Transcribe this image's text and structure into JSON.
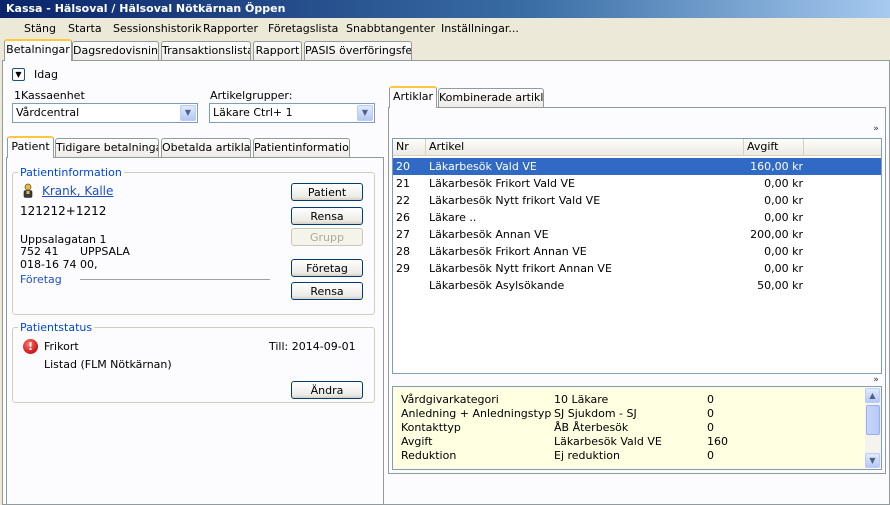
{
  "window": {
    "title": "Kassa - Hälsoval / Hälsoval Nötkärnan Öppen"
  },
  "menu": [
    "Stäng",
    "Starta",
    "Sessionshistorik",
    "Rapporter",
    "Företagslista",
    "Snabbtangenter",
    "Inställningar..."
  ],
  "main_tabs": [
    "Betalningar",
    "Dagsredovisning",
    "Transaktionslista",
    "Rapport",
    "PASIS överföringsfel"
  ],
  "date_toggle": "Idag",
  "kassaenhet": {
    "label": "1Kassaenhet",
    "value": "Vårdcentral"
  },
  "artikelgrupper": {
    "label": "Artikelgrupper:",
    "value": "Läkare Ctrl+ 1"
  },
  "patient_tabs": [
    "Patient",
    "Tidigare betalningar",
    "Obetalda artiklar",
    "Patientinformation"
  ],
  "patientinfo": {
    "title": "Patientinformation",
    "name": "Krank, Kalle",
    "pnr": "121212+1212",
    "street": "Uppsalagatan 1",
    "zip": "752 41",
    "city": "UPPSALA",
    "phone": "018-16 74 00,",
    "company_label": "Företag",
    "buttons": {
      "patient": "Patient",
      "rensa1": "Rensa",
      "grupp": "Grupp",
      "foretag": "Företag",
      "rensa2": "Rensa"
    }
  },
  "patientstatus": {
    "title": "Patientstatus",
    "status": "Frikort",
    "date": "Till: 2014-09-01",
    "listed": "Listad (FLM Nötkärnan)",
    "andra": "Ändra"
  },
  "article_tabs": [
    "Artiklar",
    "Kombinerade artiklar"
  ],
  "articles": {
    "columns": [
      "Nr",
      "Artikel",
      "Avgift"
    ],
    "rows": [
      {
        "nr": "20",
        "name": "Läkarbesök Vald VE",
        "fee": "160,00 kr"
      },
      {
        "nr": "21",
        "name": "Läkarbesök Frikort Vald VE",
        "fee": "0,00 kr"
      },
      {
        "nr": "22",
        "name": "Läkarbesök Nytt frikort Vald VE",
        "fee": "0,00 kr"
      },
      {
        "nr": "26",
        "name": "Läkare ..",
        "fee": "0,00 kr"
      },
      {
        "nr": "27",
        "name": "Läkarbesök Annan VE",
        "fee": "200,00 kr"
      },
      {
        "nr": "28",
        "name": "Läkarbesök Frikort Annan VE",
        "fee": "0,00 kr"
      },
      {
        "nr": "29",
        "name": "Läkarbesök Nytt frikort Annan VE",
        "fee": "0,00 kr"
      },
      {
        "nr": "",
        "name": "Läkarbesök Asylsökande",
        "fee": "50,00 kr"
      }
    ],
    "selected_index": 0
  },
  "details": [
    {
      "label": "Vårdgivarkategori",
      "value": "10 Läkare",
      "num": "0"
    },
    {
      "label": "Anledning + Anledningstyp",
      "value": "SJ Sjukdom - SJ",
      "num": "0"
    },
    {
      "label": "Kontakttyp",
      "value": "ÅB Återbesök",
      "num": "0"
    },
    {
      "label": "Avgift",
      "value": "Läkarbesök Vald VE",
      "num": "160"
    },
    {
      "label": "Reduktion",
      "value": "Ej reduktion",
      "num": "0"
    }
  ],
  "icons": [
    "chevron-down-icon",
    "person-icon",
    "warning-icon",
    "double-chevron-down-icon"
  ],
  "colors": {
    "title_start": "#0a246a",
    "selection": "#316ac5",
    "details_bg": "#ffffe1",
    "link": "#1f4ecc",
    "tab_accent": "#ffc83c",
    "warning": "#d42020"
  }
}
